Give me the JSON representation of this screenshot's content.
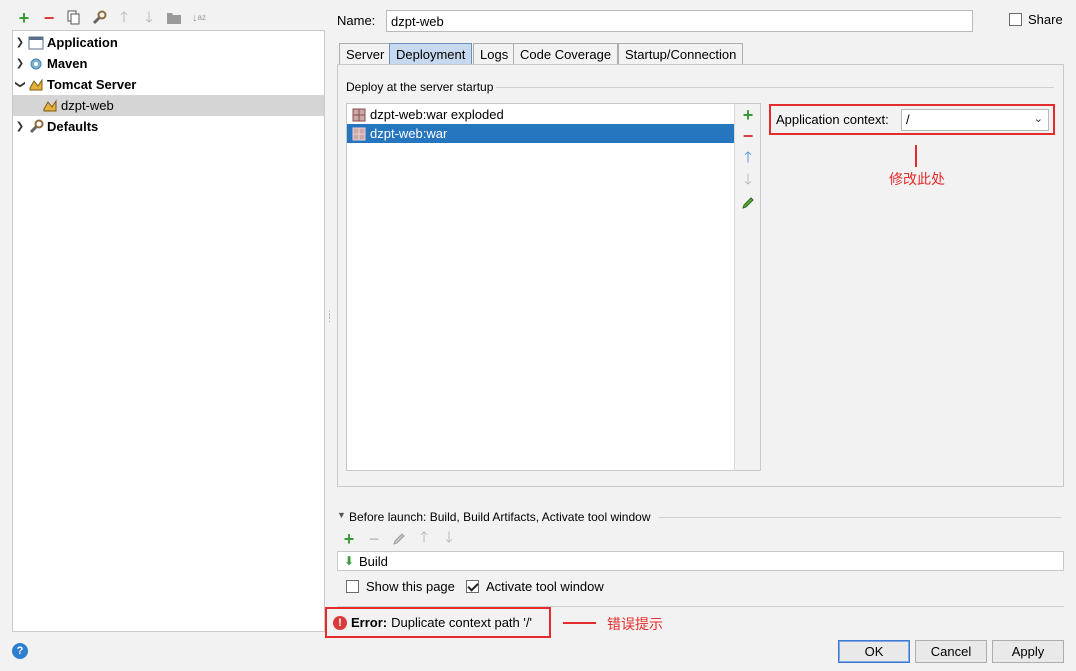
{
  "left_toolbar": {
    "icons": [
      "add-icon",
      "remove-icon",
      "copy-icon",
      "wrench-icon",
      "move-up-icon",
      "move-down-icon",
      "folder-icon",
      "sort-icon"
    ]
  },
  "tree": {
    "items": [
      {
        "label": "Application",
        "icon": "application-icon",
        "expanded": false
      },
      {
        "label": "Maven",
        "icon": "maven-icon",
        "expanded": false
      },
      {
        "label": "Tomcat Server",
        "icon": "tomcat-icon",
        "expanded": true
      },
      {
        "label": "dzpt-web",
        "icon": "tomcat-config-icon",
        "selected": true
      },
      {
        "label": "Defaults",
        "icon": "wrench-icon",
        "expanded": false
      }
    ]
  },
  "config": {
    "name_label": "Name:",
    "name_value": "dzpt-web",
    "share_label": "Share",
    "share_checked": false
  },
  "tabs": [
    {
      "label": "Server",
      "active": false
    },
    {
      "label": "Deployment",
      "active": true
    },
    {
      "label": "Logs",
      "active": false
    },
    {
      "label": "Code Coverage",
      "active": false
    },
    {
      "label": "Startup/Connection",
      "active": false
    }
  ],
  "deployment": {
    "section_title": "Deploy at the server startup",
    "artifacts": [
      {
        "label": "dzpt-web:war exploded",
        "selected": false
      },
      {
        "label": "dzpt-web:war",
        "selected": true
      }
    ],
    "context_label": "Application context:",
    "context_value": "/"
  },
  "annotations": {
    "modify_here": "修改此处",
    "error_hint": "错误提示"
  },
  "before_launch": {
    "title": "Before launch: Build, Build Artifacts, Activate tool window",
    "tasks": [
      "Build"
    ],
    "show_page_label": "Show this page",
    "show_page_checked": false,
    "activate_label": "Activate tool window",
    "activate_checked": true
  },
  "error": {
    "prefix": "Error:",
    "message": "Duplicate context path '/'"
  },
  "buttons": {
    "ok": "OK",
    "cancel": "Cancel",
    "apply": "Apply",
    "help": "?"
  },
  "colors": {
    "selection_blue": "#2675bf",
    "annotation_red": "#e52b2b",
    "add_green": "#3a9a3a",
    "remove_red": "#d93b3b"
  }
}
